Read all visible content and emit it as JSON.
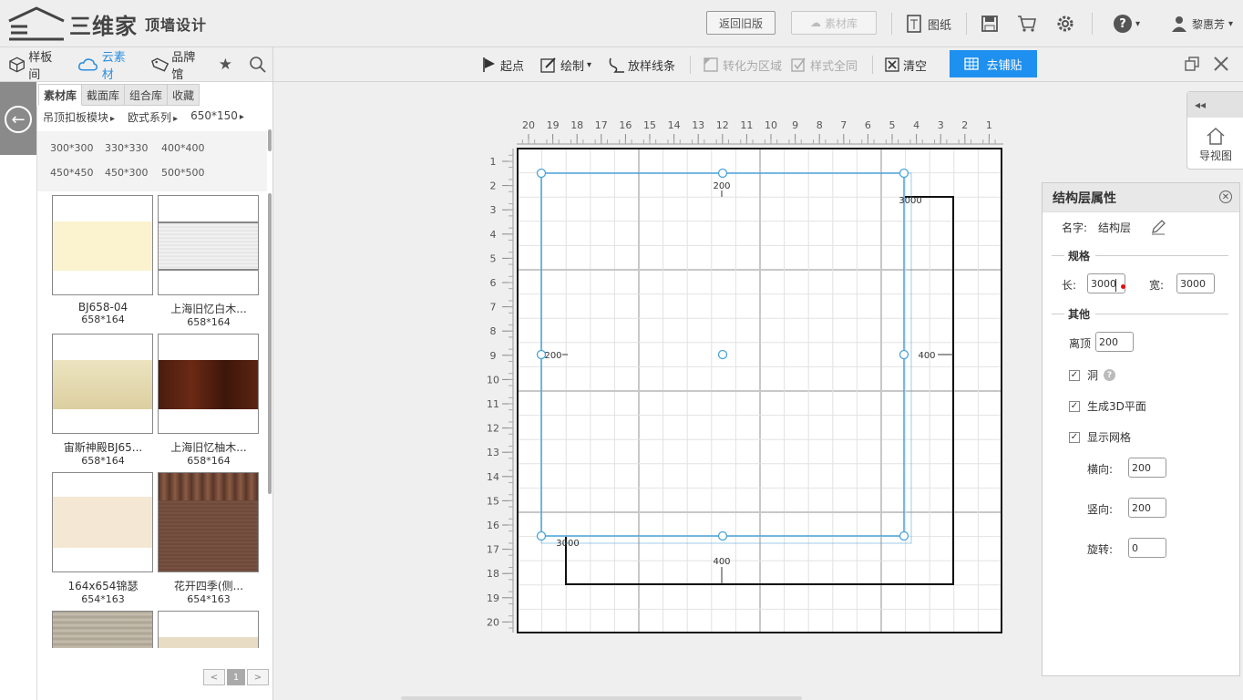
{
  "header": {
    "brand": "三维家",
    "subtitle": "顶墙设计",
    "btn_old": "返回旧版",
    "btn_material": "素材库",
    "drawing": "图纸",
    "help_caret": "▾",
    "user": "黎惠芳",
    "user_caret": "▾"
  },
  "toolbar": {
    "lib_tabs": [
      "样板间",
      "云素材",
      "品牌馆"
    ],
    "start": "起点",
    "draw": "绘制",
    "draw_caret": "▾",
    "loft": "放样线条",
    "to_region": "转化为区域",
    "style_all": "样式全同",
    "clear": "清空",
    "to_paste": "去铺贴"
  },
  "left_panel": {
    "tabs": [
      "素材库",
      "截面库",
      "组合库",
      "收藏"
    ],
    "breadcrumb": [
      "吊顶扣板模块",
      "欧式系列",
      "650*150"
    ],
    "sizes": [
      "300*300",
      "330*330",
      "400*400",
      "450*450",
      "450*300",
      "500*500"
    ],
    "items": [
      {
        "name": "BJ658-04",
        "dim": "658*164"
      },
      {
        "name": "上海旧忆白木...",
        "dim": "658*164"
      },
      {
        "name": "宙斯神殿BJ65...",
        "dim": "658*164"
      },
      {
        "name": "上海旧忆柚木...",
        "dim": "658*164"
      },
      {
        "name": "164x654锦瑟",
        "dim": "654*163"
      },
      {
        "name": "花开四季(侧...",
        "dim": "654*163"
      }
    ],
    "pager": {
      "prev": "<",
      "current": "1",
      "next": ">"
    }
  },
  "canvas": {
    "top_ruler": [
      "20",
      "19",
      "18",
      "17",
      "16",
      "15",
      "14",
      "13",
      "12",
      "11",
      "10",
      "9",
      "8",
      "7",
      "6",
      "5",
      "4",
      "3",
      "2",
      "1"
    ],
    "left_ruler": [
      "1",
      "2",
      "3",
      "4",
      "5",
      "6",
      "7",
      "8",
      "9",
      "10",
      "11",
      "12",
      "13",
      "14",
      "15",
      "16",
      "17",
      "18",
      "19",
      "20"
    ],
    "dims": {
      "top": "200",
      "left": "200",
      "right": "400",
      "bottom": "400",
      "width_top": "3000",
      "width_bottom": "3000"
    }
  },
  "view_panel": {
    "collapse": "◂◂",
    "label": "导视图"
  },
  "properties": {
    "title": "结构层属性",
    "name_label": "名字:",
    "name_value": "结构层",
    "spec_section": "规格",
    "length_label": "长:",
    "length_value": "3000",
    "width_label": "宽:",
    "width_value": "3000",
    "other_section": "其他",
    "offset_label": "离顶",
    "offset_value": "200",
    "hole_label": "洞",
    "gen3d_label": "生成3D平面",
    "grid_label": "显示网格",
    "horiz_label": "横向:",
    "horiz_value": "200",
    "vert_label": "竖向:",
    "vert_value": "200",
    "rotate_label": "旋转:",
    "rotate_value": "0"
  },
  "colors": {
    "accent": "#1e90ef",
    "selection": "#4aa3d8"
  }
}
